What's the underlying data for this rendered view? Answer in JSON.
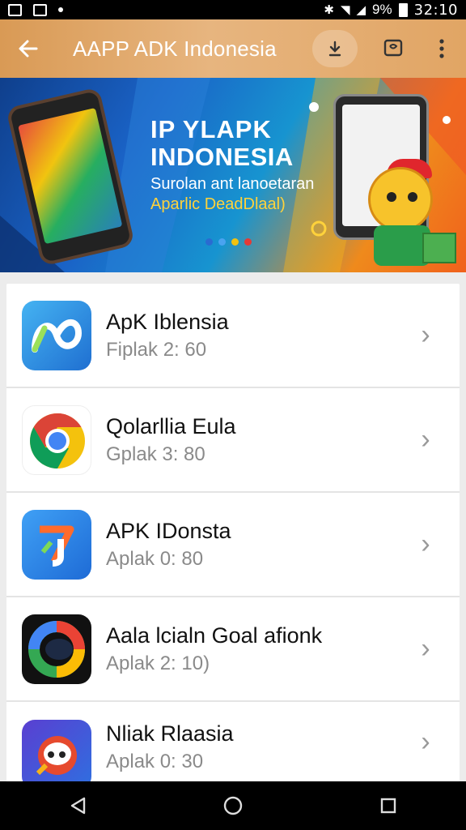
{
  "status_bar": {
    "battery": "9%",
    "time": "32:10"
  },
  "toolbar": {
    "title": "AAPP ADK Indonesia",
    "icons": [
      "back-arrow-icon",
      "download-icon",
      "chat-icon",
      "more-vert-icon"
    ]
  },
  "banner": {
    "line1": "IP YLAPK",
    "line2": "INDONESIA",
    "line3": "Surolan ant lanoetaran",
    "line4": "Aparlic DeadDlaal)",
    "dot_colors": [
      "#2a6bd1",
      "#4aa3f0",
      "#f2c20f",
      "#e53935"
    ]
  },
  "apps": [
    {
      "name": "ApK Iblensia",
      "sub": "Fiplak 2: 60",
      "icon": "loop-logo-icon",
      "icon_color": "#2f8de4"
    },
    {
      "name": "Qolarllia Eula",
      "sub": "Gplak 3: 80",
      "icon": "chrome-icon",
      "icon_color": "#ffffff"
    },
    {
      "name": "APK IDonsta",
      "sub": "Aplak 0: 80",
      "icon": "sevenj-logo-icon",
      "icon_color": "#2e86de"
    },
    {
      "name": "Aala lcialn Goal afionk",
      "sub": "Aplak 2: 10)",
      "icon": "color-ring-icon",
      "icon_color": "#111111"
    },
    {
      "name": "Nliak Rlaasia",
      "sub": "Aplak 0: 30",
      "icon": "rocket-icon",
      "icon_color": "#3b5bdb"
    }
  ],
  "nav": {
    "icons": [
      "back-triangle-icon",
      "home-circle-icon",
      "recents-square-icon"
    ]
  }
}
